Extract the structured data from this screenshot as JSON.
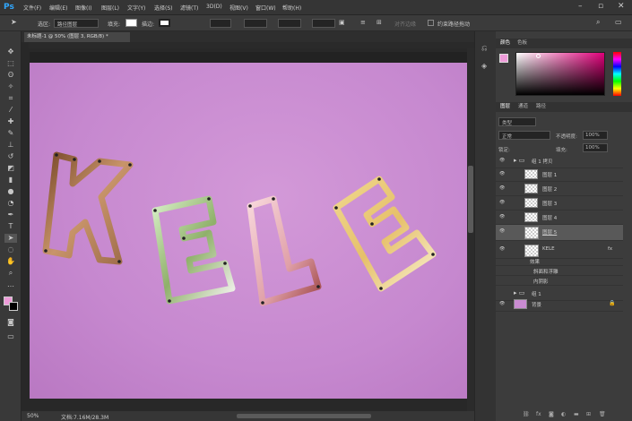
{
  "app": {
    "logo": "Ps"
  },
  "menu": [
    "文件(F)",
    "编辑(E)",
    "图像(I)",
    "图层(L)",
    "文字(Y)",
    "选择(S)",
    "滤镜(T)",
    "3D(D)",
    "视图(V)",
    "窗口(W)",
    "帮助(H)"
  ],
  "window_controls": [
    "–",
    "▫",
    "✕"
  ],
  "options": {
    "select_label": "选区:",
    "select_value": "路径图层",
    "fill_label": "填充:",
    "stroke_label": "描边:",
    "align_edges": "对齐边缘",
    "constrain": "约束路径拖动"
  },
  "document": {
    "tab": "未标题-1 @ 50% (图层 3, RGB/8) *"
  },
  "status": {
    "zoom": "50%",
    "doc": "文档:7.16M/28.3M"
  },
  "letters": [
    "K",
    "E",
    "L",
    "E"
  ],
  "colors": {
    "background": "#c98bd1",
    "foreground": "#ee9bd9"
  },
  "color_panel": {
    "tabs": [
      "颜色",
      "色板"
    ]
  },
  "layers_panel": {
    "tabs": [
      "图层",
      "通道",
      "路径"
    ],
    "kind": "类型",
    "blend": "正常",
    "opacity_label": "不透明度:",
    "opacity": "100%",
    "lock_label": "锁定:",
    "fill_label": "填充:",
    "fill": "100%",
    "rows": [
      {
        "name": "组 1 拷贝",
        "type": "group"
      },
      {
        "name": "图层 1",
        "type": "layer"
      },
      {
        "name": "图层 2",
        "type": "layer"
      },
      {
        "name": "图层 3",
        "type": "layer"
      },
      {
        "name": "图层 4",
        "type": "layer"
      },
      {
        "name": "图层 5",
        "type": "layer-selected"
      },
      {
        "name": "KELE",
        "type": "text"
      },
      {
        "name": "效果",
        "type": "effect"
      },
      {
        "name": "斜面和浮雕",
        "type": "effect"
      },
      {
        "name": "内阴影",
        "type": "effect"
      },
      {
        "name": "组 1",
        "type": "group"
      },
      {
        "name": "背景",
        "type": "bg"
      }
    ]
  }
}
